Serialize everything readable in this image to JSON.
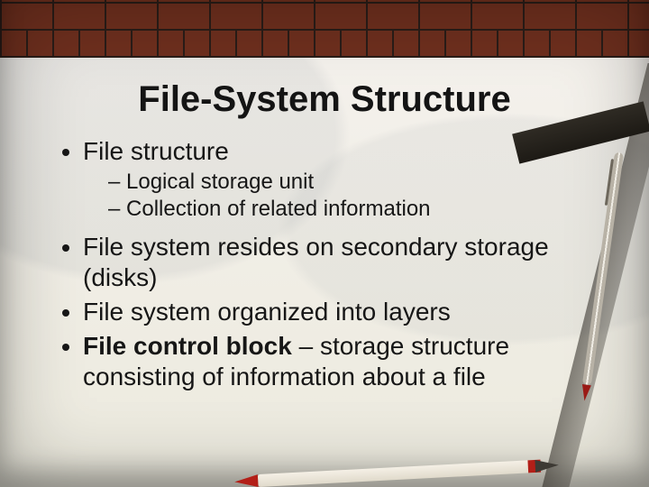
{
  "title": "File-System Structure",
  "bullets": {
    "b1": "File structure",
    "b1_sub1": "Logical storage unit",
    "b1_sub2": "Collection of related information",
    "b2": "File system resides on secondary storage (disks)",
    "b3": "File system organized into layers",
    "b4_bold": "File control block",
    "b4_rest": " – storage structure consisting of information about a file"
  }
}
